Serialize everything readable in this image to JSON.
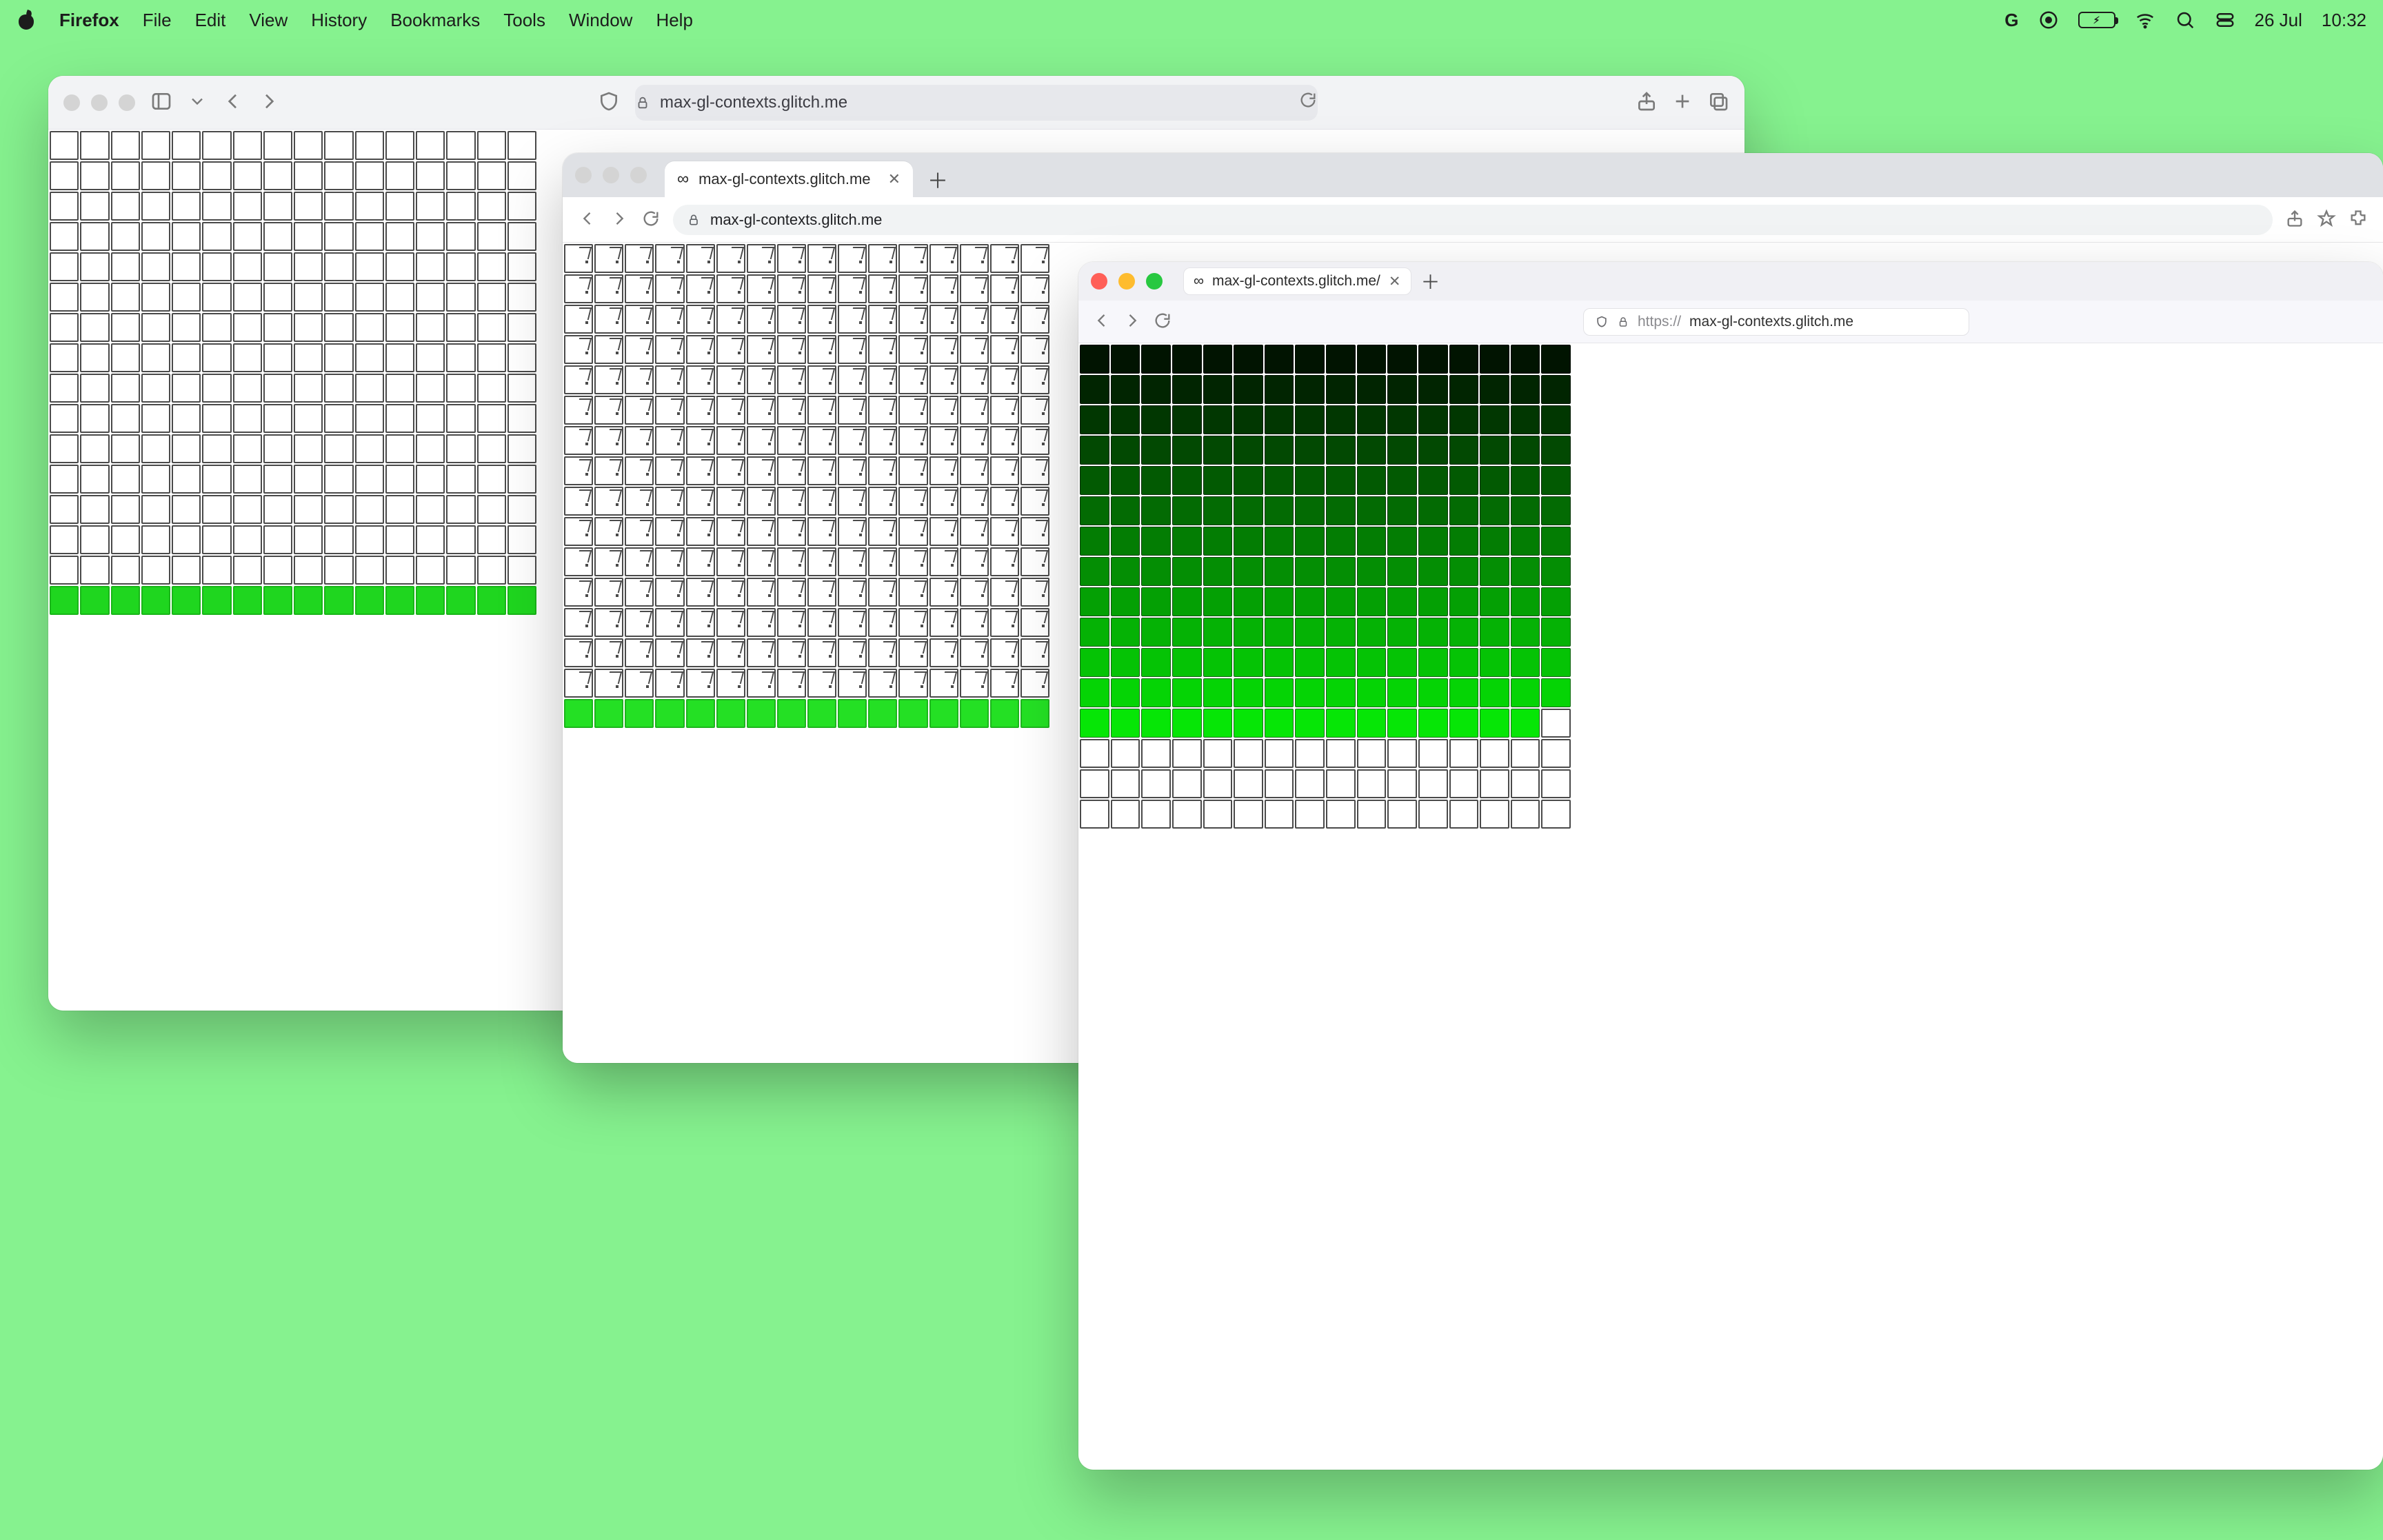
{
  "menubar": {
    "app": "Firefox",
    "items": [
      "File",
      "Edit",
      "View",
      "History",
      "Bookmarks",
      "Tools",
      "Window",
      "Help"
    ],
    "battery_label": "⚡︎",
    "date": "26 Jul",
    "time": "10:32"
  },
  "domain": "max-gl-contexts.glitch.me",
  "safari": {
    "address": "max-gl-contexts.glitch.me",
    "grid": {
      "cols": 16,
      "rows": 16,
      "green_cells": 16
    }
  },
  "chrome": {
    "tab_title": "max-gl-contexts.glitch.me",
    "tab_favicon": "∞",
    "address": "max-gl-contexts.glitch.me",
    "grid": {
      "cols": 16,
      "rows": 16,
      "green_cells": 16
    }
  },
  "firefox": {
    "tab_title": "max-gl-contexts.glitch.me/",
    "tab_favicon": "∞",
    "url_prefix": "https://",
    "url_host": "max-gl-contexts.glitch.me",
    "grid": {
      "cols": 16,
      "rows": 16,
      "filled_cells": 207
    }
  },
  "icons": {
    "apple": "apple",
    "google": "G",
    "record": "⦿",
    "wifi": "wifi",
    "search": "search",
    "control-center": "cc",
    "shield": "shield",
    "lock": "lock",
    "reload": "reload",
    "share": "share",
    "newtab": "plus",
    "tabs": "tabs",
    "sidebar": "sidebar",
    "back": "back",
    "forward": "forward",
    "chevron-down": "chev",
    "star": "star",
    "puzzle": "puzzle"
  }
}
